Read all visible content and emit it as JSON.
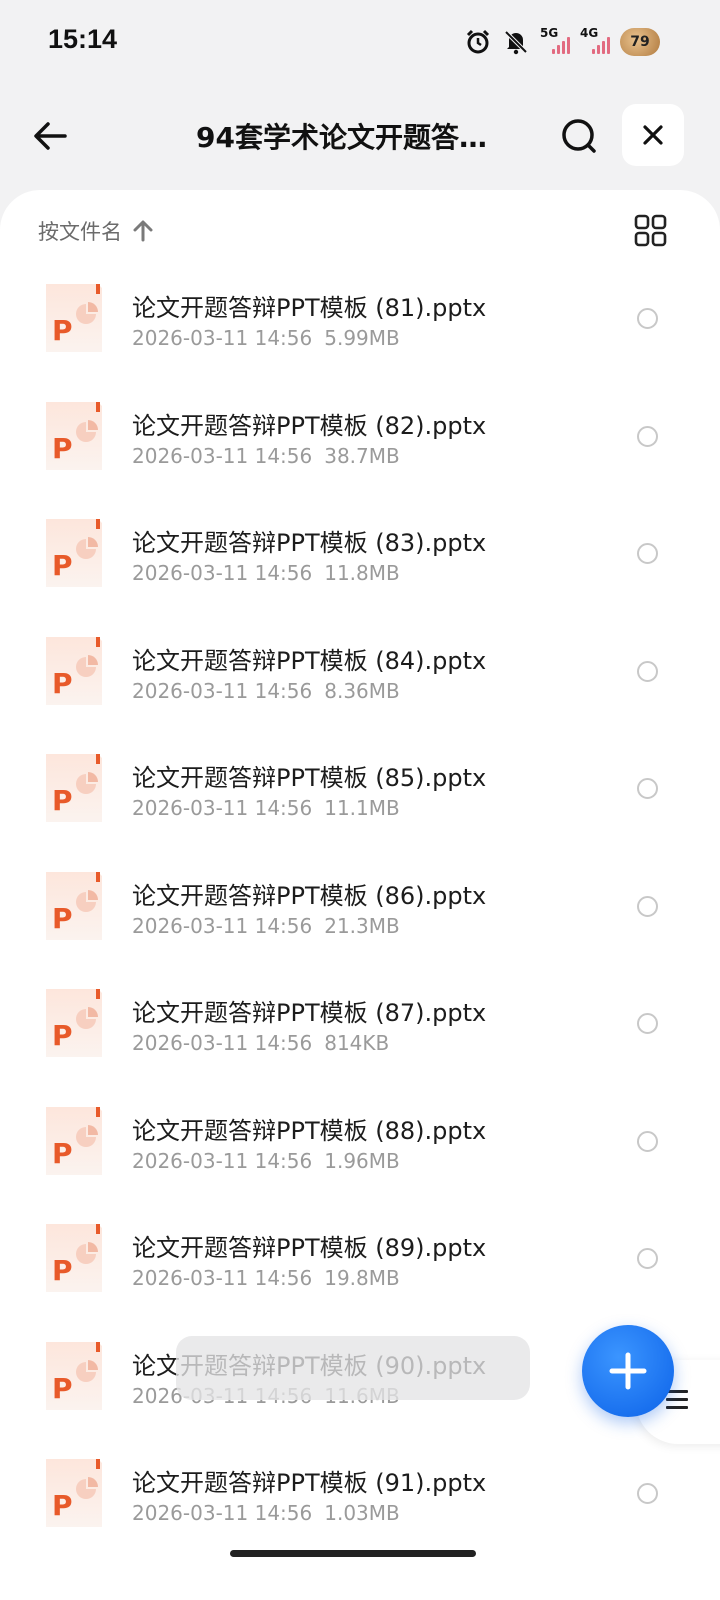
{
  "status_bar": {
    "time": "15:14",
    "icons": [
      "alarm-icon",
      "bell-muted-icon",
      "signal-5g-icon",
      "signal-4g-icon",
      "battery-icon"
    ],
    "net1": "5G",
    "net2": "4G",
    "battery": "79"
  },
  "header": {
    "title": "94套学术论文开题答…",
    "back_icon": "arrow-left-icon",
    "search_icon": "search-icon",
    "close_icon": "close-icon"
  },
  "sort": {
    "label": "按文件名",
    "direction_icon": "arrow-up-icon",
    "view_icon": "grid-view-icon"
  },
  "files": [
    {
      "name": "论文开题答辩PPT模板 (81).pptx",
      "date": "2026-03-11 14:56",
      "size": "5.99MB"
    },
    {
      "name": "论文开题答辩PPT模板 (82).pptx",
      "date": "2026-03-11 14:56",
      "size": "38.7MB"
    },
    {
      "name": "论文开题答辩PPT模板 (83).pptx",
      "date": "2026-03-11 14:56",
      "size": "11.8MB"
    },
    {
      "name": "论文开题答辩PPT模板 (84).pptx",
      "date": "2026-03-11 14:56",
      "size": "8.36MB"
    },
    {
      "name": "论文开题答辩PPT模板 (85).pptx",
      "date": "2026-03-11 14:56",
      "size": "11.1MB"
    },
    {
      "name": "论文开题答辩PPT模板 (86).pptx",
      "date": "2026-03-11 14:56",
      "size": "21.3MB"
    },
    {
      "name": "论文开题答辩PPT模板 (87).pptx",
      "date": "2026-03-11 14:56",
      "size": "814KB"
    },
    {
      "name": "论文开题答辩PPT模板 (88).pptx",
      "date": "2026-03-11 14:56",
      "size": "1.96MB"
    },
    {
      "name": "论文开题答辩PPT模板 (89).pptx",
      "date": "2026-03-11 14:56",
      "size": "19.8MB"
    },
    {
      "name": "论文开题答辩PPT模板 (90).pptx",
      "date": "2026-03-11 14:56",
      "size": "11.6MB"
    },
    {
      "name": "论文开题答辩PPT模板 (91).pptx",
      "date": "2026-03-11 14:56",
      "size": "1.03MB"
    }
  ],
  "file_icon_letter": "P",
  "fab_icon": "plus-icon",
  "side_handle_icon": "menu-icon",
  "colors": {
    "ppt_orange": "#e85a2a",
    "fab_blue": "#1473ee",
    "background": "#f2f2f3"
  }
}
